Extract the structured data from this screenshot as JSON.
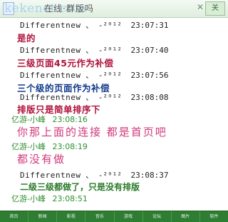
{
  "window": {
    "title": "在线·群版吗",
    "watermark": "kekenet.com",
    "close_glyph": "✕",
    "right_button": "关"
  },
  "messages": [
    {
      "header": {
        "sender": "Differentnew",
        "sep": "、 -²⁰¹²",
        "time": "23:07:31"
      },
      "text": "是的",
      "style": "red"
    },
    {
      "header": {
        "sender": "Differentnew",
        "sep": "、 -²⁰¹²",
        "time": "23:07:40"
      },
      "text": "三级页面45元作为补偿",
      "style": "red"
    },
    {
      "header": {
        "sender": "Differentnew",
        "sep": "、 -²⁰¹²",
        "time": "23:07:56"
      },
      "text": "三个级的页面作为补偿",
      "style": "blue"
    },
    {
      "header": {
        "sender": "Differentnew",
        "sep": "、 -²⁰¹²",
        "time": "23:08:08"
      },
      "text": "排版只是简单排序下",
      "style": "red"
    },
    {
      "gheader": {
        "sender": "亿游-小峰",
        "time": "23:08:16"
      },
      "text": "你那上面的连接 都是首页吧",
      "style": "pink"
    },
    {
      "gheader": {
        "sender": "亿游-小峰",
        "time": "23:08:19"
      },
      "text": "都没有做",
      "style": "pink"
    },
    {
      "header": {
        "sender": "Differentnew",
        "sep": "、 -²⁰¹²",
        "time": "23:08:37"
      },
      "text": "二级三级都做了，只是没有排版",
      "style": "green"
    },
    {
      "gheader": {
        "sender": "亿游-小峰",
        "time": "23:08:51"
      }
    }
  ],
  "bottom_bar": {
    "items": [
      "首页",
      "新闻",
      "影视",
      "音乐",
      "游戏",
      "论坛",
      "图片",
      "软件"
    ]
  }
}
